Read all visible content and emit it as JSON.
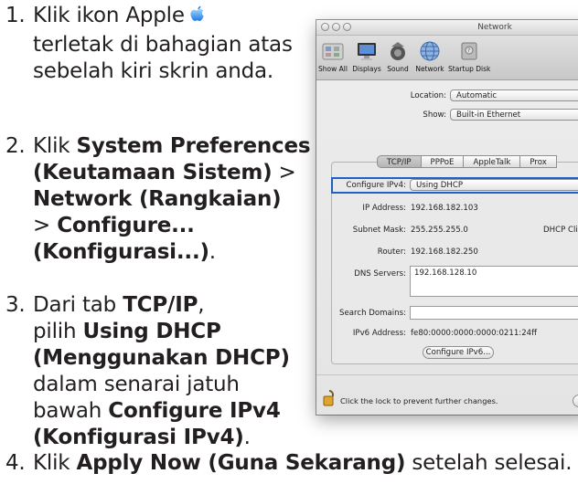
{
  "steps": {
    "s1": {
      "num": "1.",
      "line1": "Klik ikon Apple",
      "line2": "terletak di bahagian atas",
      "line3": "sebelah kiri skrin anda."
    },
    "s2": {
      "num": "2.",
      "line1_pre": "Klik ",
      "line1_bold": "System Preferences",
      "line2_bold": "(Keutamaan Sistem)",
      "line2_post": " >",
      "line3_bold": "Network (Rangkaian)",
      "line4": "> ",
      "line4_bold": "Configure...",
      "line5_bold": "(Konfigurasi...)",
      "line5_post": "."
    },
    "s3": {
      "num": "3.",
      "line1_pre": "Dari tab ",
      "line1_bold": "TCP/IP",
      "line1_post": ",",
      "line2_pre": "pilih ",
      "line2_bold": "Using DHCP",
      "line3_bold": "(Menggunakan DHCP)",
      "line4": "dalam senarai jatuh",
      "line5_pre": "bawah ",
      "line5_bold": "Configure IPv4",
      "line6_bold": "(Konfigurasi IPv4)",
      "line6_post": "."
    },
    "s4": {
      "num": "4.",
      "pre": "Klik ",
      "bold": "Apply Now (Guna Sekarang)",
      "post": " setelah selesai."
    }
  },
  "window": {
    "title": "Network",
    "toolbar": [
      "Show All",
      "Displays",
      "Sound",
      "Network",
      "Startup Disk"
    ],
    "location_label": "Location:",
    "location_value": "Automatic",
    "show_label": "Show:",
    "show_value": "Built-in Ethernet",
    "tabs": [
      "TCP/IP",
      "PPPoE",
      "AppleTalk",
      "Prox"
    ],
    "configure_label": "Configure IPv4:",
    "configure_value": "Using DHCP",
    "ip_label": "IP Address:",
    "ip_value": "192.168.182.103",
    "subnet_label": "Subnet Mask:",
    "subnet_value": "255.255.255.0",
    "dhcp_client_label": "DHCP Cli",
    "router_label": "Router:",
    "router_value": "192.168.182.250",
    "dns_label": "DNS Servers:",
    "dns_value": "192.168.128.10",
    "search_label": "Search Domains:",
    "ipv6_label": "IPv6 Address:",
    "ipv6_value": "fe80:0000:0000:0000:0211:24ff",
    "configure_ipv6_button": "Configure IPv6...",
    "lock_text": "Click the lock to prevent further changes."
  }
}
